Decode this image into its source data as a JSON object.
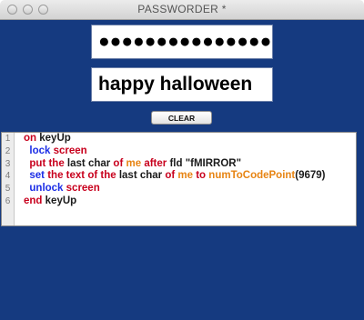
{
  "window": {
    "title": "PASSWORDER *"
  },
  "password_field": {
    "masked_value": "●●●●●●●●●●●●●●●"
  },
  "text_field": {
    "value": "happy halloween"
  },
  "clear_button": {
    "label": "CLEAR"
  },
  "editor": {
    "line_numbers": [
      "1",
      "2",
      "3",
      "4",
      "5",
      "6"
    ],
    "lines": [
      [
        {
          "text": "on",
          "color": "red"
        },
        {
          "text": " keyUp",
          "color": "black"
        }
      ],
      [
        {
          "text": "  lock",
          "color": "blue"
        },
        {
          "text": " screen",
          "color": "red"
        }
      ],
      [
        {
          "text": "  put",
          "color": "red"
        },
        {
          "text": " the",
          "color": "red"
        },
        {
          "text": " last char",
          "color": "black"
        },
        {
          "text": " of",
          "color": "red"
        },
        {
          "text": " me",
          "color": "orange"
        },
        {
          "text": " after",
          "color": "red"
        },
        {
          "text": " fld \"fMIRROR\"",
          "color": "black"
        }
      ],
      [
        {
          "text": "  set",
          "color": "blue"
        },
        {
          "text": " the",
          "color": "red"
        },
        {
          "text": " text",
          "color": "red"
        },
        {
          "text": " of",
          "color": "red"
        },
        {
          "text": " the",
          "color": "red"
        },
        {
          "text": " last char",
          "color": "black"
        },
        {
          "text": " of",
          "color": "red"
        },
        {
          "text": " me",
          "color": "orange"
        },
        {
          "text": " to",
          "color": "red"
        },
        {
          "text": " numToCodePoint",
          "color": "orange"
        },
        {
          "text": "(9679)",
          "color": "black"
        }
      ],
      [
        {
          "text": "  unlock",
          "color": "blue"
        },
        {
          "text": " screen",
          "color": "red"
        }
      ],
      [
        {
          "text": "end",
          "color": "red"
        },
        {
          "text": " keyUp",
          "color": "black"
        }
      ]
    ],
    "colors": {
      "red": "#c8001d",
      "blue": "#1c2ee6",
      "orange": "#e78413",
      "black": "#1a1a1a"
    }
  },
  "theme": {
    "background": "#153a80"
  }
}
